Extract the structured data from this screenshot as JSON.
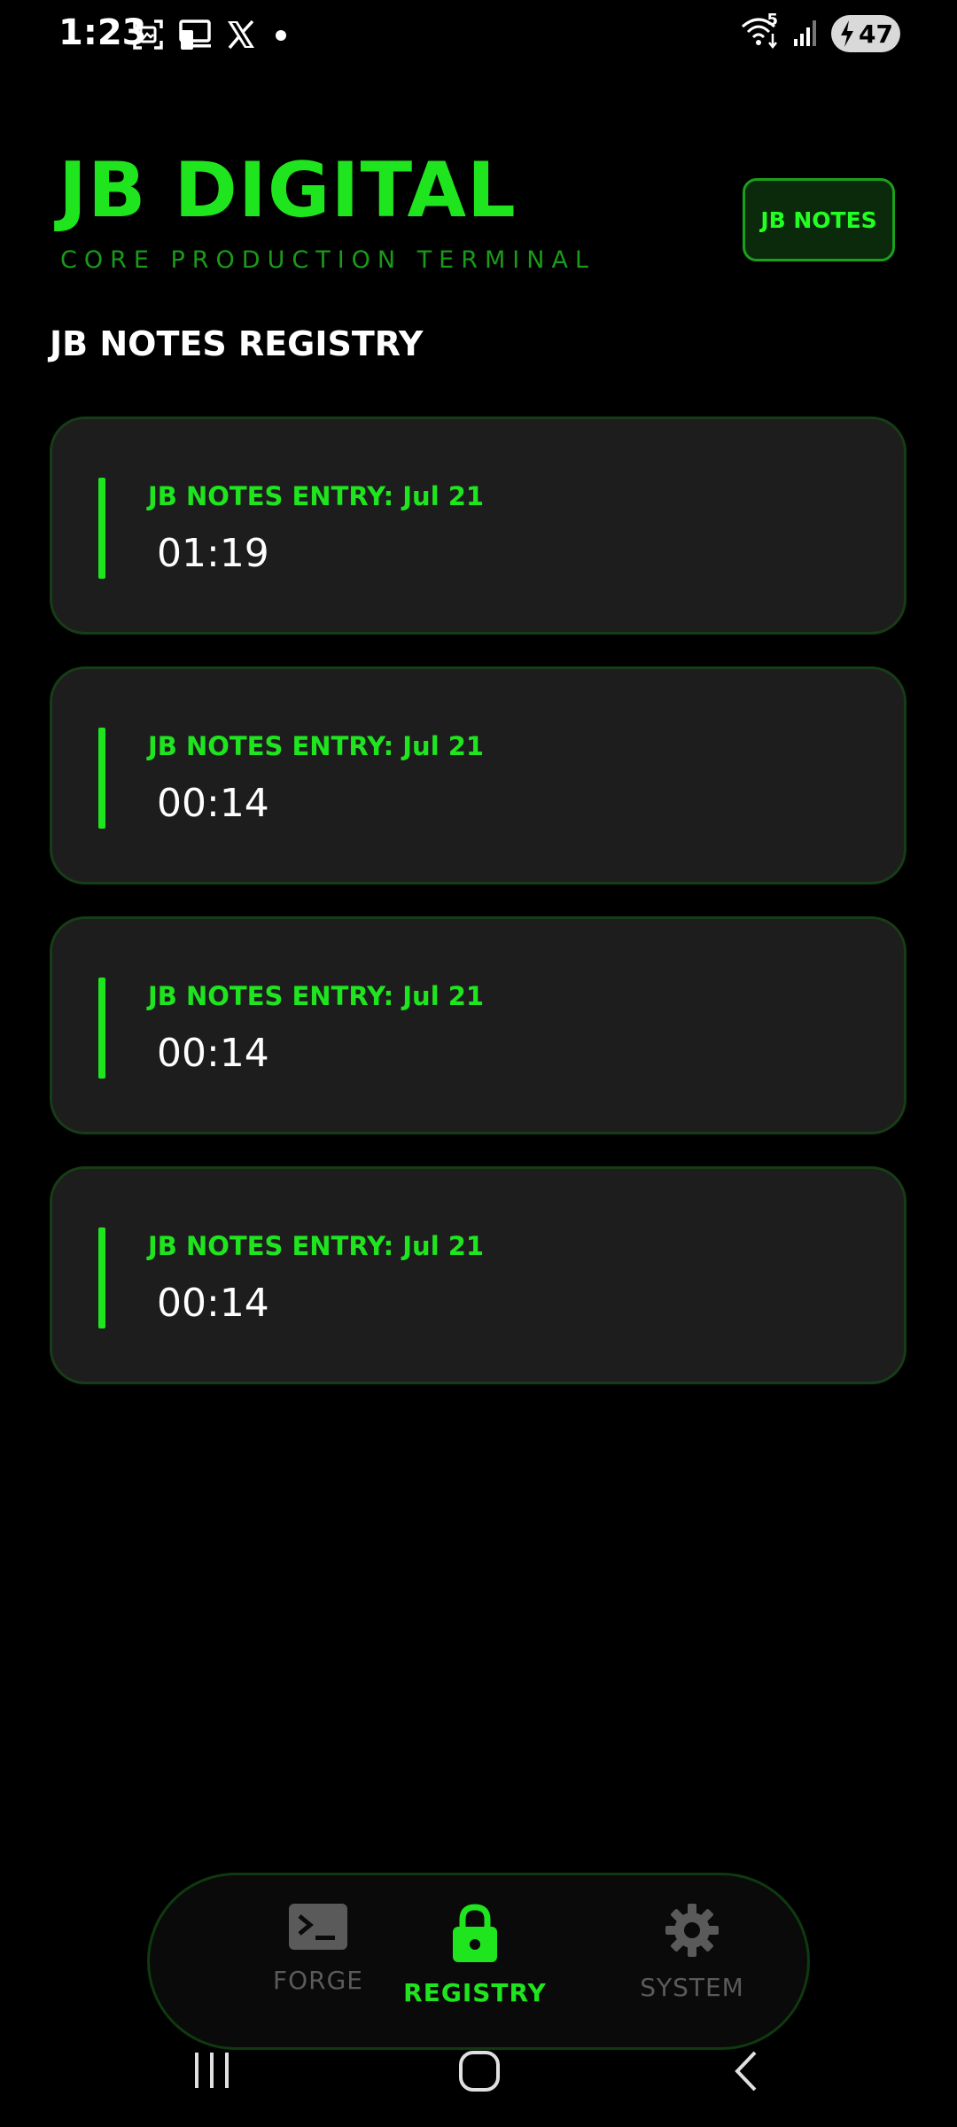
{
  "status_bar": {
    "time": "1:23",
    "signal_badge": "5",
    "battery": "47",
    "left_icons": [
      "screenshot-icon",
      "cast-icon",
      "x-logo-icon",
      "notification-dot-icon"
    ],
    "right_icons": [
      "wifi-icon",
      "signal-icon",
      "battery-icon"
    ]
  },
  "header": {
    "title": "JB DIGITAL",
    "subtitle": "CORE PRODUCTION TERMINAL",
    "button_label": "JB NOTES"
  },
  "section": {
    "title": "JB NOTES REGISTRY"
  },
  "entries": [
    {
      "label": "JB NOTES ENTRY: Jul 21",
      "time": "01:19"
    },
    {
      "label": "JB NOTES ENTRY: Jul 21",
      "time": "00:14"
    },
    {
      "label": "JB NOTES ENTRY: Jul 21",
      "time": "00:14"
    },
    {
      "label": "JB NOTES ENTRY: Jul 21",
      "time": "00:14"
    }
  ],
  "nav": {
    "items": [
      {
        "label": "FORGE",
        "icon": "terminal-icon",
        "active": false
      },
      {
        "label": "REGISTRY",
        "icon": "lock-icon",
        "active": true
      },
      {
        "label": "SYSTEM",
        "icon": "gear-icon",
        "active": false
      }
    ]
  },
  "colors": {
    "accent": "#1fe51f",
    "inactive": "#5a5a5a",
    "card_bg": "#1d1d1d",
    "background": "#000000"
  }
}
